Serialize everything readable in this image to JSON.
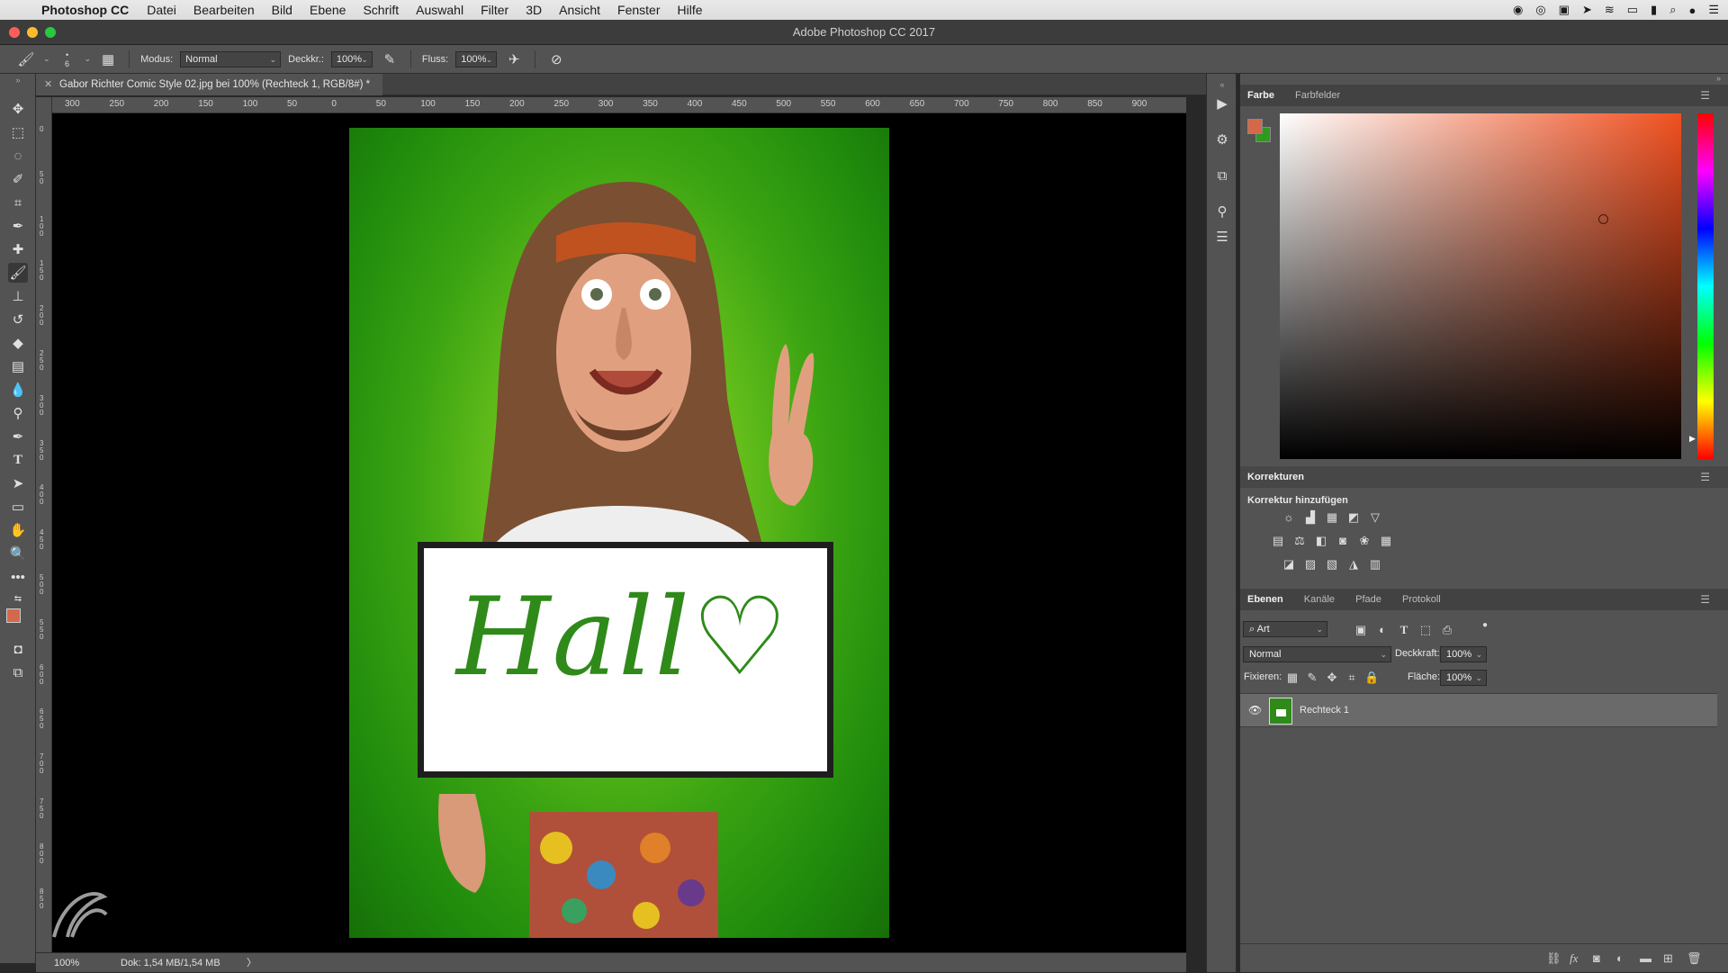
{
  "menubar": {
    "app_name": "Photoshop CC",
    "items": [
      "Datei",
      "Bearbeiten",
      "Bild",
      "Ebene",
      "Schrift",
      "Auswahl",
      "Filter",
      "3D",
      "Ansicht",
      "Fenster",
      "Hilfe"
    ]
  },
  "window": {
    "title": "Adobe Photoshop CC 2017"
  },
  "options_bar": {
    "brush_size": "6",
    "mode_label": "Modus:",
    "mode_value": "Normal",
    "opacity_label": "Deckkr.:",
    "opacity_value": "100%",
    "flow_label": "Fluss:",
    "flow_value": "100%"
  },
  "document": {
    "tab_title": "Gabor Richter Comic Style 02.jpg bei 100% (Rechteck 1, RGB/8#) *",
    "sign_text": "Hall♡",
    "ruler_top": [
      "300",
      "250",
      "200",
      "150",
      "100",
      "50",
      "0",
      "50",
      "100",
      "150",
      "200",
      "250",
      "300",
      "350",
      "400",
      "450",
      "500",
      "550",
      "600",
      "650",
      "700",
      "750",
      "800",
      "850",
      "900"
    ],
    "ruler_left": [
      "0",
      "5 0",
      "1 0 0",
      "1 5 0",
      "2 0 0",
      "2 5 0",
      "3 0 0",
      "3 5 0",
      "4 0 0",
      "4 5 0",
      "5 0 0",
      "5 5 0",
      "6 0 0",
      "6 5 0",
      "7 0 0",
      "7 5 0",
      "8 0 0",
      "8 5 0"
    ]
  },
  "statusbar": {
    "zoom": "100%",
    "doc_info": "Dok: 1,54 MB/1,54 MB",
    "arrow": "〉"
  },
  "color_panel": {
    "tabs": [
      "Farbe",
      "Farbfelder"
    ],
    "foreground_color": "#d3694a",
    "background_color": "#2f9a1f"
  },
  "adjustments_panel": {
    "title": "Korrekturen",
    "subtitle": "Korrektur hinzufügen"
  },
  "layers_panel": {
    "tabs": [
      "Ebenen",
      "Kanäle",
      "Pfade",
      "Protokoll"
    ],
    "filter_value": "Art",
    "blend_mode": "Normal",
    "opacity_label": "Deckkraft:",
    "opacity_value": "100%",
    "lock_label": "Fixieren:",
    "fill_label": "Fläche:",
    "fill_value": "100%",
    "layers": [
      {
        "name": "Rechteck 1",
        "visible": true
      }
    ]
  }
}
